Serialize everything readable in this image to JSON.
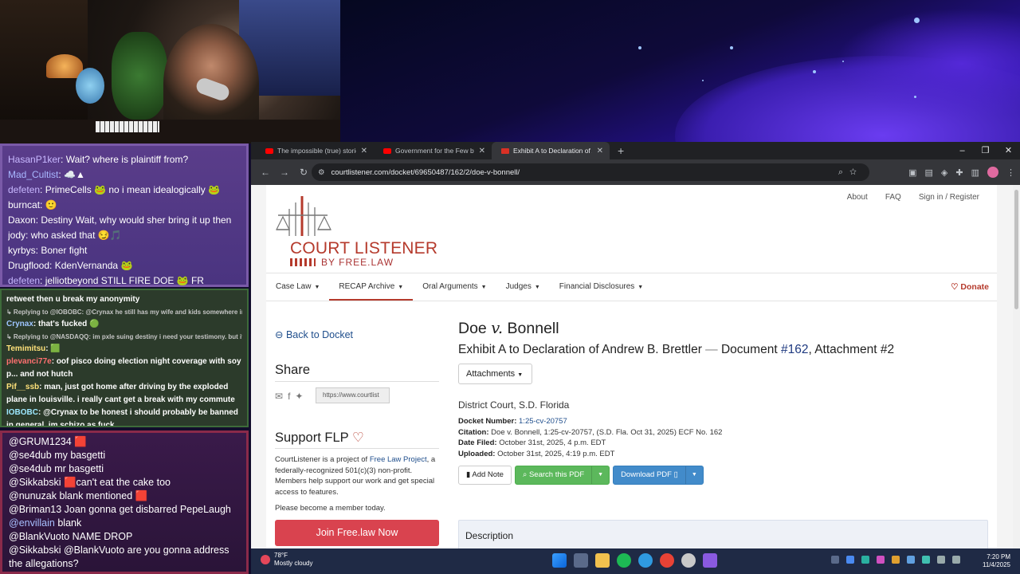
{
  "chat_top": [
    {
      "user": "HasanP1ker",
      "text": "Wait? where is plaintiff from?"
    },
    {
      "user": "Mad_Cultist",
      "text": "☁️▲"
    },
    {
      "user": "defeten",
      "text": "PrimeCells 🐸 no i mean idealogically 🐸"
    },
    {
      "user": "burncat",
      "text": "🙂"
    },
    {
      "user": "Daxon",
      "text": "Destiny Wait, why would sher bring it up then"
    },
    {
      "user": "jody",
      "text": "who asked that 😏🎵"
    },
    {
      "user": "kyrbys",
      "text": "Boner fight"
    },
    {
      "user": "Drugflood",
      "text": "KdenVernanda 🐸"
    },
    {
      "user": "defeten",
      "text": "jelliotbeyond STILL FIRE DOE 🐸 FR"
    }
  ],
  "chat_mid": [
    {
      "type": "msg",
      "user": "",
      "text": "retweet then u break my anonymity"
    },
    {
      "type": "reply",
      "text": "↳ Replying to @IOBOBC: @Crynax he still has my wife and kids somewhere in ..."
    },
    {
      "type": "msg",
      "user": "Crynax",
      "text": "that's fucked 🟢"
    },
    {
      "type": "reply",
      "text": "↳ Replying to @NASDAQQ: im pxle suing destiny i need your testimony. but if u ..."
    },
    {
      "type": "msg",
      "user": "Temimitsu",
      "text": "🟩"
    },
    {
      "type": "msg",
      "user": "plevanci77e",
      "text": "oof pisco doing election night coverage with soy p... and not hutch"
    },
    {
      "type": "msg",
      "user": "Pif__ssb",
      "text": "man, just got home after driving by the exploded plane in louisville. i really cant get a break with my commute"
    },
    {
      "type": "msg",
      "user": "IOBOBC",
      "text": "@Crynax to be honest i should probably be banned in general, im schizo as fuck"
    }
  ],
  "chat_bottom": [
    {
      "user": "@GRUM1234",
      "text": "🟥"
    },
    {
      "user": "@se4dub",
      "text": "my basgetti"
    },
    {
      "user": "@se4dub",
      "text": "mr basgetti"
    },
    {
      "user": "@Sikkabski",
      "text": "🟥can't eat the cake too"
    },
    {
      "user": "@nunuzak",
      "text": "blank mentioned 🟥"
    },
    {
      "user": "@Briman13",
      "text": "Joan gonna get disbarred PepeLaugh"
    },
    {
      "user": "@envillain",
      "text": "blank"
    },
    {
      "user": "@BlankVuoto",
      "text": "NAME DROP"
    },
    {
      "user": "@Sikkabski",
      "text": "@BlankVuoto are you gonna address the allegations?"
    }
  ],
  "browser": {
    "tabs": [
      {
        "title": "The impossible (true) stories be..."
      },
      {
        "title": "Government for the Few by the ..."
      },
      {
        "title": "Exhibit A to Declaration of And..."
      }
    ],
    "url": "courtlistener.com/docket/69650487/162/2/doe-v-bonnell/"
  },
  "site": {
    "top_links": [
      "About",
      "FAQ",
      "Sign in / Register"
    ],
    "logo_text": "COURT LISTENER",
    "logo_sub": "BY FREE.LAW",
    "nav": [
      "Case Law",
      "RECAP Archive",
      "Oral Arguments",
      "Judges",
      "Financial Disclosures"
    ],
    "donate": "Donate",
    "back_link": "Back to Docket",
    "share_title": "Share",
    "share_url": "https://www.courtlist",
    "support_title": "Support FLP",
    "support_text_a": "CourtListener is a project of",
    "support_link": "Free Law Project",
    "support_text_b": ", a federally-recognized 501(c)(3) non-profit. Members help support our work and get special access to features.",
    "become_member": "Please become a member today.",
    "join_button": "Join Free.law Now",
    "case_a": "Doe",
    "case_v": "v.",
    "case_b": "Bonnell",
    "exhibit_prefix": "Exhibit A to Declaration of Andrew B. Brettler",
    "exhibit_sep": "—",
    "exhibit_doc_label": "Document",
    "exhibit_doc_num": "#162",
    "exhibit_attach": ", Attachment #2",
    "attachments_button": "Attachments",
    "court_name": "District Court, S.D. Florida",
    "docket_label": "Docket Number:",
    "docket_value": "1:25-cv-20757",
    "citation_label": "Citation:",
    "citation_value": "Doe v. Bonnell, 1:25-cv-20757, (S.D. Fla. Oct 31, 2025) ECF No. 162",
    "filed_label": "Date Filed:",
    "filed_value": "October 31st, 2025, 4 p.m. EDT",
    "uploaded_label": "Uploaded:",
    "uploaded_value": "October 31st, 2025, 4:19 p.m. EDT",
    "add_note": "Add Note",
    "search_pdf": "Search this PDF",
    "download_pdf": "Download PDF",
    "description_label": "Description"
  },
  "taskbar": {
    "temp": "78°F",
    "weather": "Mostly cloudy",
    "time": "7:20 PM",
    "date": "11/4/2025"
  }
}
